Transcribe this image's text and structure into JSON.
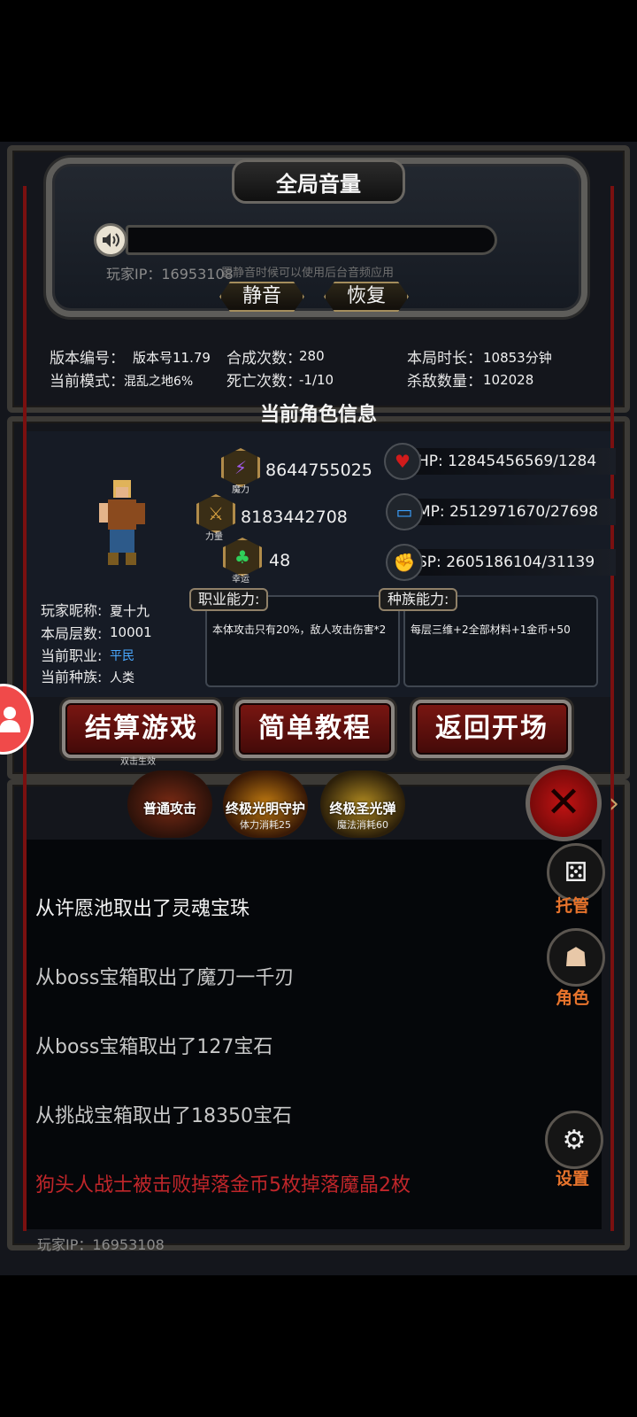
{
  "volume": {
    "title": "全局音量",
    "ip_text": "玩家IP：16953108",
    "hint": "置静音时候可以使用后台音频应用",
    "mute_label": "静音",
    "restore_label": "恢复"
  },
  "stats": {
    "version_label": "版本编号：",
    "version_value": "版本号11.79",
    "mode_label": "当前模式：",
    "mode_value": "混乱之地6%",
    "synth_label": "合成次数：",
    "synth_value": "280",
    "death_label": "死亡次数：",
    "death_value": "-1/10",
    "time_label": "本局时长：",
    "time_value": "10853分钟",
    "kills_label": "杀敌数量：",
    "kills_value": "102028"
  },
  "section_title": "当前角色信息",
  "attributes": {
    "magic": {
      "label": "魔力",
      "value": "8644755025",
      "icon": "lightning-icon"
    },
    "strength": {
      "label": "力量",
      "value": "8183442708",
      "icon": "sword-icon"
    },
    "luck": {
      "label": "幸运",
      "value": "48",
      "icon": "clover-icon"
    }
  },
  "vitals": {
    "hp": {
      "label": "HP:",
      "value": "12845456569/1284",
      "icon": "heart-icon",
      "color": "#d11b1b"
    },
    "mp": {
      "label": "MP:",
      "value": "2512971670/27698",
      "icon": "mana-icon",
      "color": "#3aa0ff"
    },
    "sp": {
      "label": "SP:",
      "value": "2605186104/31139",
      "icon": "muscle-icon",
      "color": "#e0b21a"
    }
  },
  "player": {
    "nickname_label": "玩家昵称:",
    "nickname": "夏十九",
    "floor_label": "本局层数:",
    "floor": "10001",
    "class_label": "当前职业:",
    "class": "平民",
    "race_label": "当前种族:",
    "race": "人类"
  },
  "abilities": {
    "class_tag": "职业能力:",
    "class_text": "本体攻击只有20%，敌人攻击伤害*2",
    "race_tag": "种族能力:",
    "race_text": "每层三维+2全部材料+1金币+50"
  },
  "buttons": {
    "settle": "结算游戏",
    "settle_sub": "双击生效",
    "tutorial": "简单教程",
    "back": "返回开场"
  },
  "skills": [
    {
      "name": "普通攻击",
      "cost": ""
    },
    {
      "name": "终极光明守护",
      "cost": "体力消耗25"
    },
    {
      "name": "终极圣光弹",
      "cost": "魔法消耗60"
    }
  ],
  "log": [
    {
      "text": "从许愿池取出了灵魂宝珠",
      "color": "#f2f2f2"
    },
    {
      "text": "从boss宝箱取出了魔刀一千刃",
      "color": "#c8c8c8"
    },
    {
      "text": "从boss宝箱取出了127宝石",
      "color": "#c8c8c8"
    },
    {
      "text": "从挑战宝箱取出了18350宝石",
      "color": "#c8c8c8"
    },
    {
      "text": "狗头人战士被击败掉落金币5枚掉落魔晶2枚",
      "color": "#c0262a"
    }
  ],
  "bottom_ip": "玩家IP：16953108",
  "side": {
    "auto_label": "托管",
    "char_label": "角色",
    "settings_label": "设置"
  }
}
